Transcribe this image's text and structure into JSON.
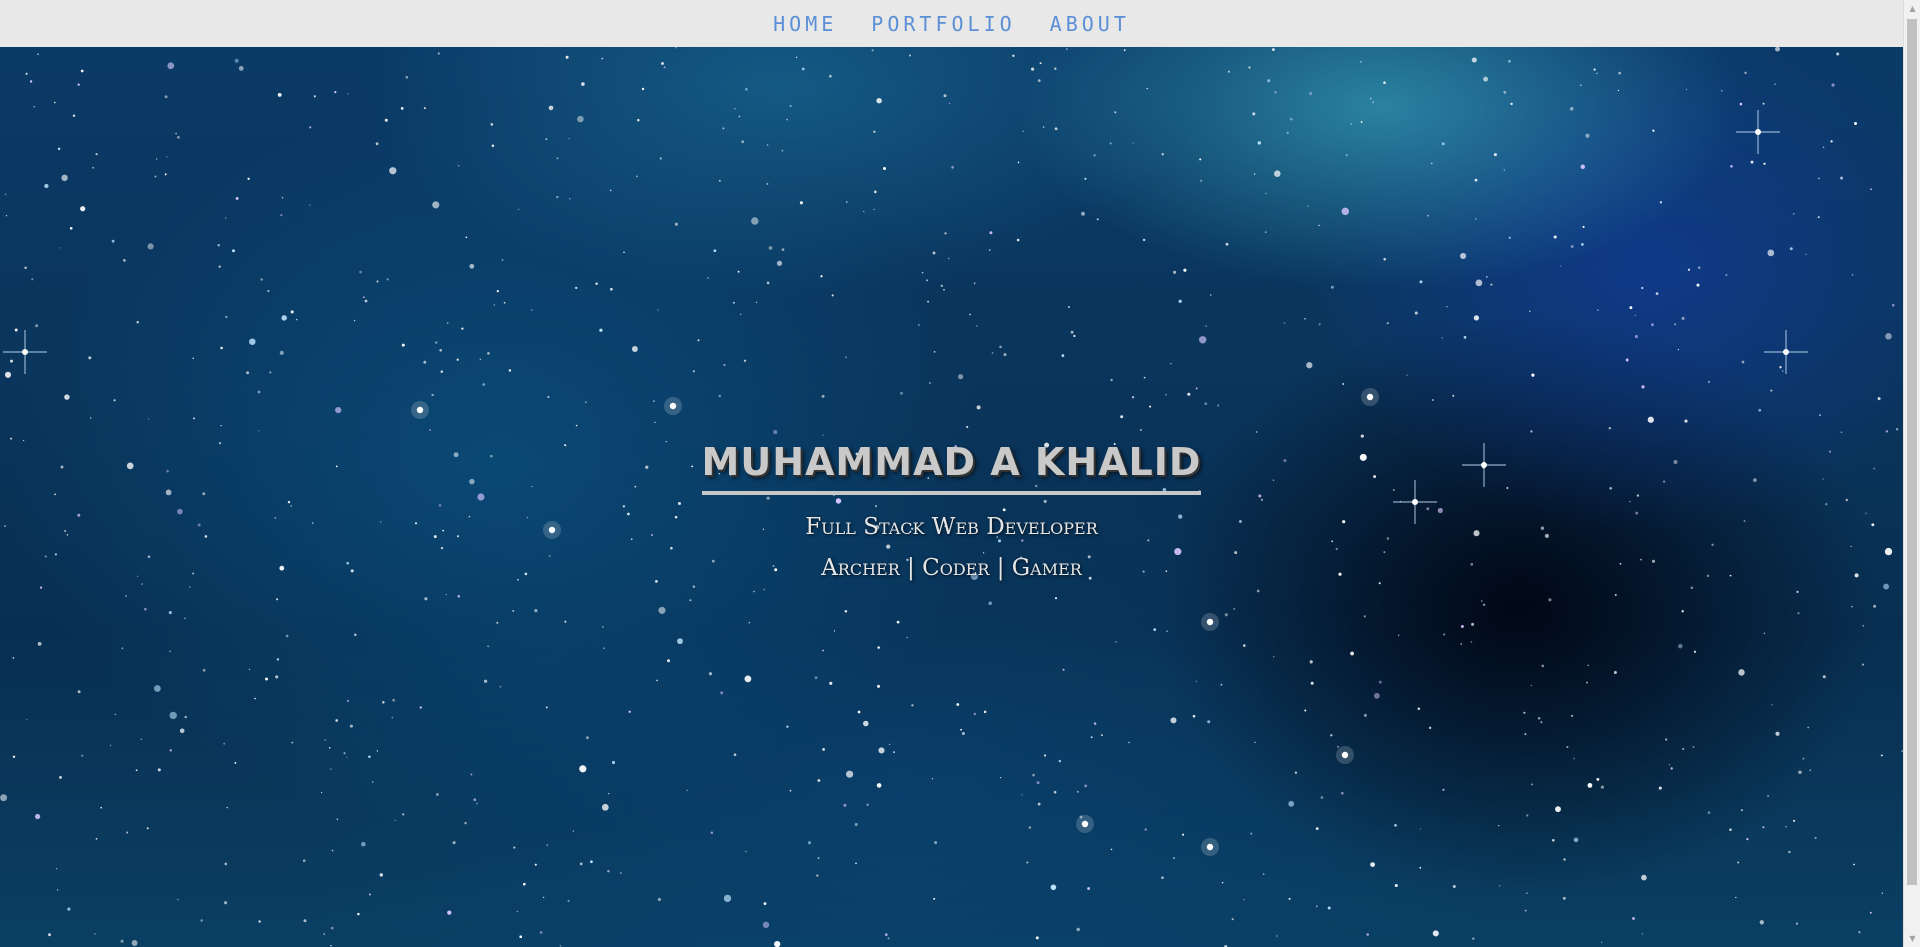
{
  "nav": {
    "links": [
      {
        "label": "HOME"
      },
      {
        "label": "PORTFOLIO"
      },
      {
        "label": "ABOUT"
      }
    ]
  },
  "hero": {
    "name": "MUHAMMAD A KHALID",
    "subtitle": "Full Stack Web Developer",
    "tagline": "Archer | Coder | Gamer"
  },
  "colors": {
    "nav_background": "#e8e8e8",
    "nav_link": "#5b8fd6",
    "space_dark": "#082f52",
    "nebula_cyan": "#46bed2"
  },
  "icons": {
    "scroll_up": "scroll-up-arrow-icon",
    "scroll_down": "scroll-down-arrow-icon"
  }
}
